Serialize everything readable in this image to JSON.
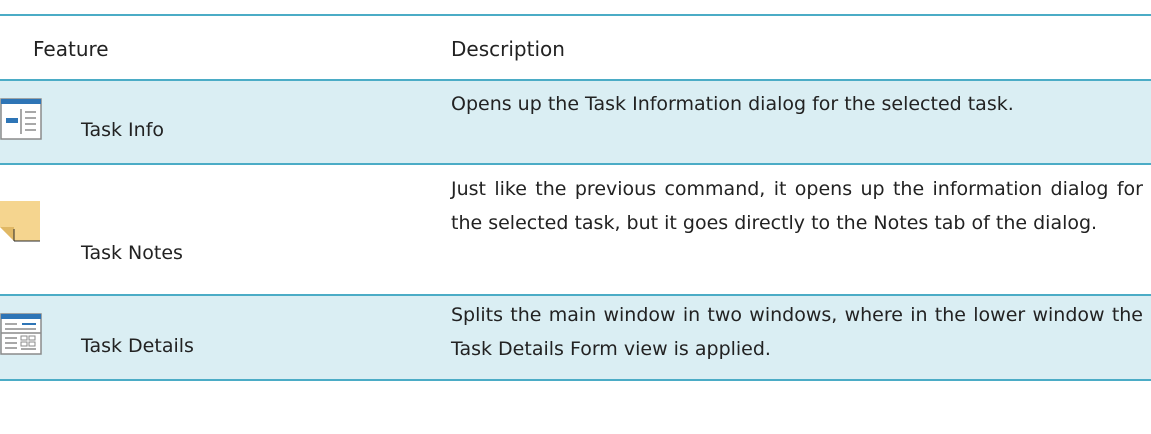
{
  "header": {
    "feature": "Feature",
    "description": "Description"
  },
  "rows": [
    {
      "icon": "task-info-icon",
      "feature": "Task Info",
      "description": "Opens up the Task Information dialog for the selected task."
    },
    {
      "icon": "task-notes-icon",
      "feature": "Task Notes",
      "description": "Just like the previous command, it opens up the information dialog for the selected task, but it goes directly to the Notes tab of the dialog."
    },
    {
      "icon": "task-details-icon",
      "feature": "Task Details",
      "description": "Splits the main window in two windows, where in the lower window the Task Details Form view is applied."
    }
  ],
  "colors": {
    "rule": "#4bacc6",
    "shaded_row": "#daeef3",
    "icon_blue": "#2e75b6",
    "note_yellow": "#f5d58f"
  }
}
